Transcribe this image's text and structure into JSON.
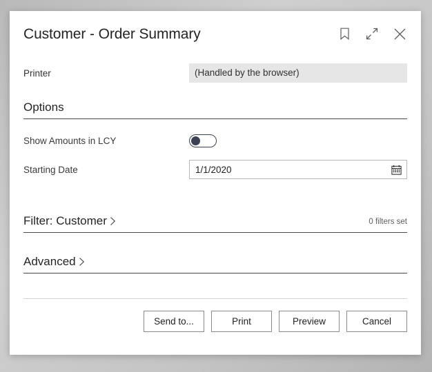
{
  "dialog": {
    "title": "Customer - Order Summary",
    "header_icons": [
      {
        "name": "bookmark-icon",
        "label": "Bookmark"
      },
      {
        "name": "expand-icon",
        "label": "Expand"
      },
      {
        "name": "close-icon",
        "label": "Close"
      }
    ]
  },
  "printer": {
    "label": "Printer",
    "value": "(Handled by the browser)"
  },
  "options": {
    "heading": "Options",
    "show_amounts": {
      "label": "Show Amounts in LCY",
      "state": "off"
    },
    "starting_date": {
      "label": "Starting Date",
      "value": "1/1/2020",
      "placeholder": "",
      "icon": "calendar-icon"
    }
  },
  "filter_section": {
    "title": "Filter: Customer",
    "chevron": "chevron-right-icon",
    "meta": "0 filters set"
  },
  "advanced_section": {
    "title": "Advanced",
    "chevron": "chevron-right-icon"
  },
  "footer": {
    "buttons": [
      {
        "label": "Send to..."
      },
      {
        "label": "Print"
      },
      {
        "label": "Preview"
      },
      {
        "label": "Cancel"
      }
    ]
  },
  "colors": {
    "accent": "#3b4256",
    "field_readonly_bg": "#e7e6e6",
    "text_primary": "#252423",
    "text_secondary": "#605e5c"
  }
}
